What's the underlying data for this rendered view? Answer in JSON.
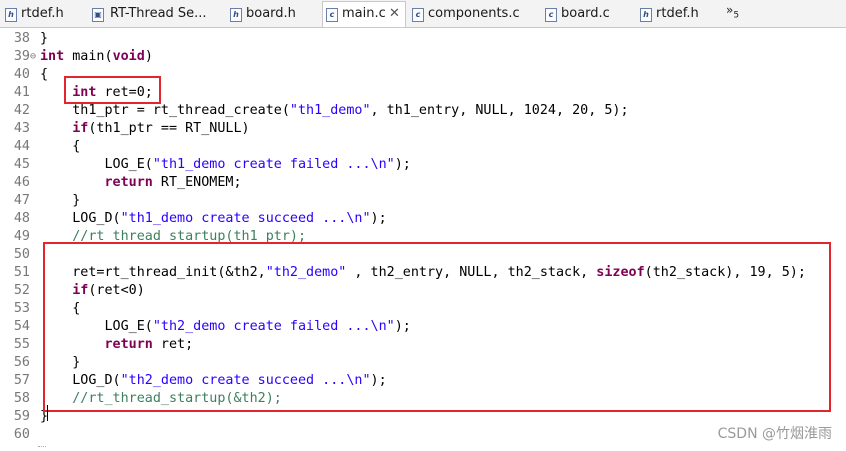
{
  "tabs": [
    {
      "icon": "h",
      "label": "rtdef.h",
      "active": false
    },
    {
      "icon": "▣",
      "label": "RT-Thread Se...",
      "active": false
    },
    {
      "icon": "h",
      "label": "board.h",
      "active": false
    },
    {
      "icon": "c",
      "label": "main.c",
      "active": true,
      "close": "✕"
    },
    {
      "icon": "c",
      "label": "components.c",
      "active": false
    },
    {
      "icon": "c",
      "label": "board.c",
      "active": false
    },
    {
      "icon": "h",
      "label": "rtdef.h",
      "active": false
    }
  ],
  "overflow": {
    "chevron": "»",
    "count": "5"
  },
  "lines": [
    {
      "n": "38",
      "fold": "",
      "tokens": [
        {
          "t": "}",
          "c": ""
        }
      ]
    },
    {
      "n": "39",
      "fold": "⊖",
      "tokens": [
        {
          "t": "int",
          "c": "kw"
        },
        {
          "t": " main(",
          "c": ""
        },
        {
          "t": "void",
          "c": "kw"
        },
        {
          "t": ")",
          "c": ""
        }
      ]
    },
    {
      "n": "40",
      "fold": "",
      "tokens": [
        {
          "t": "{",
          "c": ""
        }
      ]
    },
    {
      "n": "41",
      "fold": "",
      "tokens": [
        {
          "t": "    ",
          "c": ""
        },
        {
          "t": "int",
          "c": "kw"
        },
        {
          "t": " ret=0;",
          "c": ""
        }
      ]
    },
    {
      "n": "42",
      "fold": "",
      "tokens": [
        {
          "t": "    th1_ptr = rt_thread_create(",
          "c": ""
        },
        {
          "t": "\"th1_demo\"",
          "c": "str"
        },
        {
          "t": ", th1_entry, NULL, 1024, 20, 5);",
          "c": ""
        }
      ]
    },
    {
      "n": "43",
      "fold": "",
      "tokens": [
        {
          "t": "    ",
          "c": ""
        },
        {
          "t": "if",
          "c": "kw"
        },
        {
          "t": "(th1_ptr == RT_NULL)",
          "c": ""
        }
      ]
    },
    {
      "n": "44",
      "fold": "",
      "tokens": [
        {
          "t": "    {",
          "c": ""
        }
      ]
    },
    {
      "n": "45",
      "fold": "",
      "tokens": [
        {
          "t": "        LOG_E(",
          "c": ""
        },
        {
          "t": "\"th1_demo create failed ...\\n\"",
          "c": "str"
        },
        {
          "t": ");",
          "c": ""
        }
      ]
    },
    {
      "n": "46",
      "fold": "",
      "tokens": [
        {
          "t": "        ",
          "c": ""
        },
        {
          "t": "return",
          "c": "kw"
        },
        {
          "t": " RT_ENOMEM;",
          "c": ""
        }
      ]
    },
    {
      "n": "47",
      "fold": "",
      "tokens": [
        {
          "t": "    }",
          "c": ""
        }
      ]
    },
    {
      "n": "48",
      "fold": "",
      "tokens": [
        {
          "t": "    LOG_D(",
          "c": ""
        },
        {
          "t": "\"th1_demo create succeed ...\\n\"",
          "c": "str"
        },
        {
          "t": ");",
          "c": ""
        }
      ]
    },
    {
      "n": "49",
      "fold": "",
      "tokens": [
        {
          "t": "    ",
          "c": ""
        },
        {
          "t": "//rt_thread_startup(th1_ptr);",
          "c": "cmt"
        }
      ]
    },
    {
      "n": "50",
      "fold": "",
      "tokens": []
    },
    {
      "n": "51",
      "fold": "",
      "tokens": [
        {
          "t": "    ret=rt_thread_init(&th2,",
          "c": ""
        },
        {
          "t": "\"th2_demo\"",
          "c": "str"
        },
        {
          "t": " , th2_entry, NULL, th2_stack, ",
          "c": ""
        },
        {
          "t": "sizeof",
          "c": "kw"
        },
        {
          "t": "(th2_stack), 19, 5);",
          "c": ""
        }
      ]
    },
    {
      "n": "52",
      "fold": "",
      "tokens": [
        {
          "t": "    ",
          "c": ""
        },
        {
          "t": "if",
          "c": "kw"
        },
        {
          "t": "(ret<0)",
          "c": ""
        }
      ]
    },
    {
      "n": "53",
      "fold": "",
      "tokens": [
        {
          "t": "    {",
          "c": ""
        }
      ]
    },
    {
      "n": "54",
      "fold": "",
      "tokens": [
        {
          "t": "        LOG_E(",
          "c": ""
        },
        {
          "t": "\"th2_demo create failed ...\\n\"",
          "c": "str"
        },
        {
          "t": ");",
          "c": ""
        }
      ]
    },
    {
      "n": "55",
      "fold": "",
      "tokens": [
        {
          "t": "        ",
          "c": ""
        },
        {
          "t": "return",
          "c": "kw"
        },
        {
          "t": " ret;",
          "c": ""
        }
      ]
    },
    {
      "n": "56",
      "fold": "",
      "tokens": [
        {
          "t": "    }",
          "c": ""
        }
      ]
    },
    {
      "n": "57",
      "fold": "",
      "tokens": [
        {
          "t": "    LOG_D(",
          "c": ""
        },
        {
          "t": "\"th2_demo create succeed ...\\n\"",
          "c": "str"
        },
        {
          "t": ");",
          "c": ""
        }
      ]
    },
    {
      "n": "58",
      "fold": "",
      "tokens": [
        {
          "t": "    ",
          "c": ""
        },
        {
          "t": "//rt_thread_startup(&th2);",
          "c": "cmt"
        }
      ]
    },
    {
      "n": "59",
      "fold": "",
      "tokens": [
        {
          "t": "}",
          "c": ""
        }
      ]
    },
    {
      "n": "60",
      "fold": "",
      "tokens": []
    }
  ],
  "watermark": "CSDN @竹烟淮雨",
  "colors": {
    "keyword": "#7f0055",
    "string": "#2a00ff",
    "comment": "#3f7f5f",
    "highlight_box": "#e3262d"
  }
}
